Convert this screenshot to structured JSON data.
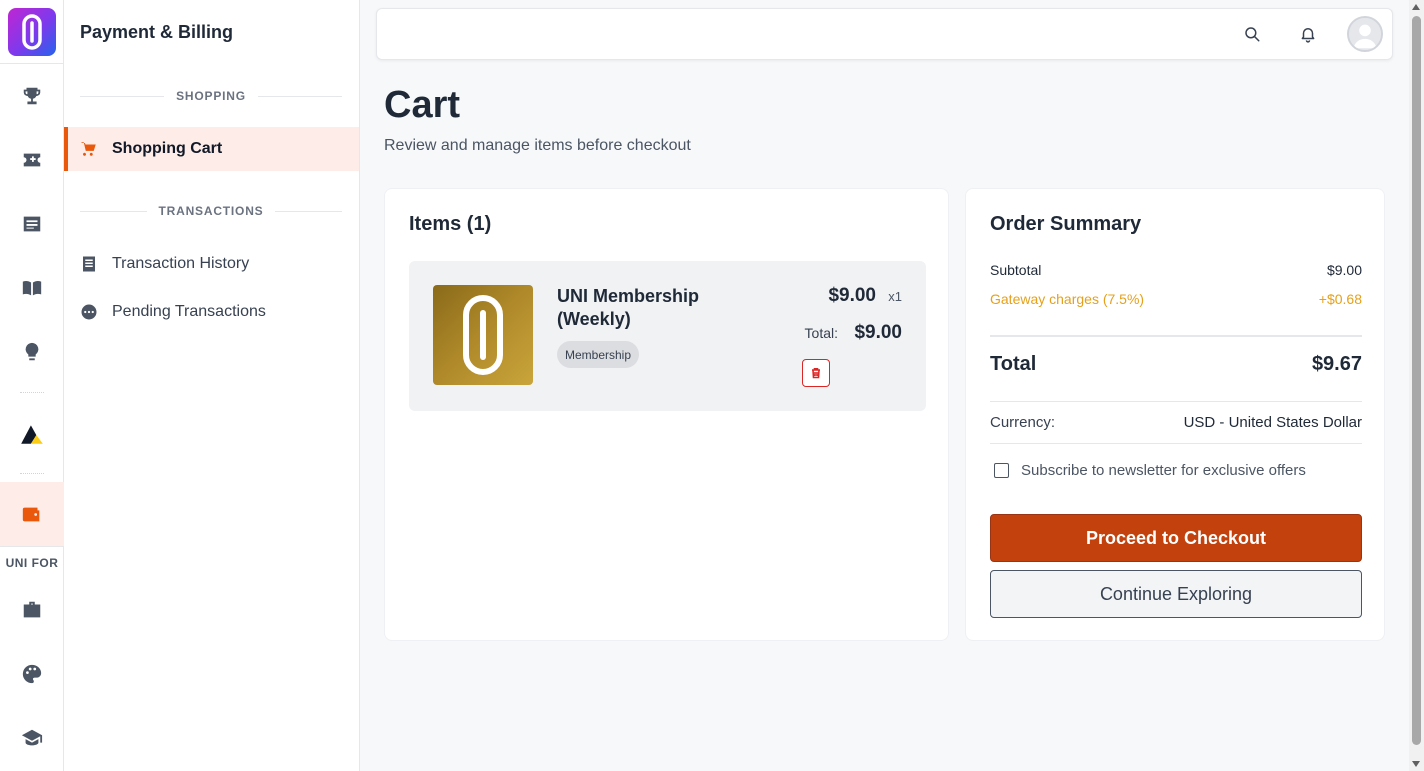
{
  "rail": {
    "logo_icon": "paperclip-logo-icon",
    "items": [
      {
        "icon": "trophy-icon",
        "active": false
      },
      {
        "icon": "ticket-icon",
        "active": false
      },
      {
        "icon": "news-icon",
        "active": false
      },
      {
        "icon": "book-icon",
        "active": false
      },
      {
        "icon": "lightbulb-icon",
        "active": false
      },
      {
        "icon": "triangle-logo-icon",
        "active": false
      },
      {
        "icon": "wallet-icon",
        "active": true
      },
      {
        "icon": "briefcase-icon",
        "active": false
      },
      {
        "icon": "palette-icon",
        "active": false
      },
      {
        "icon": "graduation-cap-icon",
        "active": false
      }
    ],
    "caption": "UNI FOR"
  },
  "panel": {
    "title": "Payment & Billing",
    "section_shopping": "SHOPPING",
    "section_transactions": "TRANSACTIONS",
    "items": [
      {
        "label": "Shopping Cart",
        "icon": "cart-icon",
        "active": true
      },
      {
        "label": "Transaction History",
        "icon": "receipt-icon",
        "active": false
      },
      {
        "label": "Pending Transactions",
        "icon": "pending-icon",
        "active": false
      }
    ]
  },
  "topbar": {
    "search_icon": "search-icon",
    "bell_icon": "bell-icon",
    "avatar_icon": "user-avatar-icon"
  },
  "page": {
    "title": "Cart",
    "subtitle": "Review and manage items before checkout"
  },
  "items_card": {
    "title": "Items (1)",
    "items": [
      {
        "name": "UNI Membership (Weekly)",
        "badge": "Membership",
        "price": "$9.00",
        "qty": "x1",
        "total_label": "Total:",
        "total": "$9.00",
        "delete_icon": "trash-icon"
      }
    ]
  },
  "summary": {
    "title": "Order Summary",
    "subtotal_label": "Subtotal",
    "subtotal_value": "$9.00",
    "gateway_label": "Gateway charges (7.5%)",
    "gateway_value": "+$0.68",
    "total_label": "Total",
    "total_value": "$9.67",
    "currency_label": "Currency:",
    "currency_value": "USD - United States Dollar",
    "newsletter_label": "Subscribe to newsletter for exclusive offers",
    "newsletter_checked": false,
    "checkout_label": "Proceed to Checkout",
    "explore_label": "Continue Exploring"
  },
  "colors": {
    "accent": "#ea580c",
    "checkout_button": "#c2410c",
    "gateway_text": "#e5a11c",
    "active_bg": "#fdece7"
  }
}
